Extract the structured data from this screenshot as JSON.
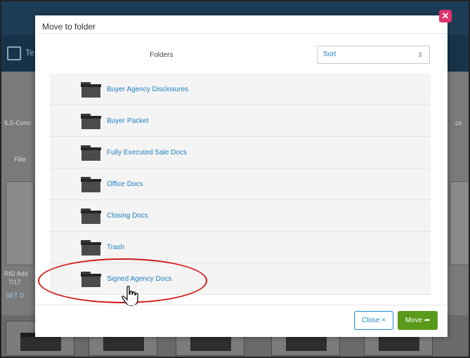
{
  "dialog": {
    "title": "Move to folder",
    "folders_header": "Folders",
    "sort": {
      "selected": "Sort",
      "arrows": "⇕"
    },
    "folders": [
      {
        "name": "Buyer Agency Disclosures"
      },
      {
        "name": "Buyer Packet"
      },
      {
        "name": "Fully Executed Sale Docs"
      },
      {
        "name": "Office Docs"
      },
      {
        "name": "Closing Docs"
      },
      {
        "name": "Trash"
      },
      {
        "name": "Signed Agency Docs"
      }
    ],
    "close_label": "Close ×",
    "move_label": "Move ➦",
    "close_x": "✕"
  },
  "background": {
    "bar_title": "Te",
    "left_texts": [
      "Filte",
      "RID Add",
      "7/17",
      "SET D",
      "ILS-Conn",
      "cs"
    ]
  },
  "colors": {
    "accent_blue": "#1f7fc0",
    "move_green": "#5a9a1a",
    "annotation_red": "#d21b1b",
    "close_pink": "#e0336c"
  }
}
